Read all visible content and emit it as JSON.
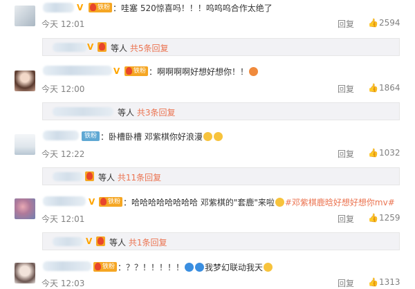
{
  "comments": [
    {
      "text": "：哇塞 520惊喜吗！！！呜呜呜合作太绝了",
      "time": "今天 12:01",
      "reply": "回复",
      "likes": "2594",
      "sub": {
        "prefix": "等人",
        "link": "共5条回复"
      }
    },
    {
      "text": "：啊啊啊啊好想好想你！！",
      "time": "今天 12:00",
      "reply": "回复",
      "likes": "1864",
      "sub": {
        "prefix": "等人",
        "link": "共3条回复"
      }
    },
    {
      "badge": "铁粉",
      "text": "：卧槽卧槽 邓紫棋你好浪漫",
      "time": "今天 12:22",
      "reply": "回复",
      "likes": "1032",
      "sub": {
        "prefix": "等人",
        "link": "共11条回复"
      }
    },
    {
      "text": "：哈哈哈哈哈哈哈哈  邓紫棋的\"套鹿\"来啦",
      "topic": "#邓紫棋鹿晗好想好想你mv#",
      "time": "今天 12:01",
      "reply": "回复",
      "likes": "1259",
      "sub": {
        "prefix": "等人",
        "link": "共1条回复"
      }
    },
    {
      "text": "：？？！！！！！",
      "text2": "我梦幻联动我天",
      "time": "今天 12:03",
      "reply": "回复",
      "likes": "1313"
    }
  ],
  "icons": {
    "like": "thumbs-up-icon",
    "verified": "v-badge-icon",
    "fan": "fan-badge-icon"
  },
  "colors": {
    "link": "#eb7350",
    "meta": "#808080",
    "badge": "#f5a623",
    "sub_bg": "#f2f2f5"
  }
}
